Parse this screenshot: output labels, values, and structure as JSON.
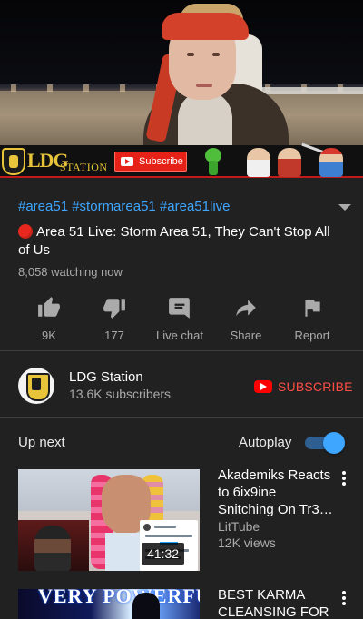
{
  "banner": {
    "logo_text": "LDG",
    "logo_subtext": "STATION",
    "subscribe_label": "Subscribe"
  },
  "video": {
    "hashtags": "#area51 #stormarea51 #area51live",
    "title": "Area 51 Live: Storm Area 51, They Can't Stop All of Us",
    "watching": "8,058 watching now"
  },
  "actions": {
    "like": {
      "label": "9K",
      "icon": "thumbs-up-icon"
    },
    "dislike": {
      "label": "177",
      "icon": "thumbs-down-icon"
    },
    "chat": {
      "label": "Live chat",
      "icon": "chat-icon"
    },
    "share": {
      "label": "Share",
      "icon": "share-arrow-icon"
    },
    "report": {
      "label": "Report",
      "icon": "flag-icon"
    }
  },
  "channel": {
    "name": "LDG Station",
    "subscribers": "13.6K subscribers",
    "subscribe_label": "SUBSCRIBE"
  },
  "upnext": {
    "heading": "Up next",
    "autoplay_label": "Autoplay",
    "autoplay_on": true,
    "items": [
      {
        "title": "Akademiks Reacts to 6ix9ine Snitching On Tr3…",
        "channel": "LitTube",
        "views": "12K views",
        "duration": "41:32"
      },
      {
        "title": "BEST KARMA CLEANSING FOR",
        "thumb_text": "VERY POWERFUL"
      }
    ]
  },
  "colors": {
    "background": "#212121",
    "accent_blue": "#3ea6ff",
    "subscribe_red": "#ff4e45",
    "live_red": "#e8281f",
    "secondary_text": "#aaaaaa"
  }
}
